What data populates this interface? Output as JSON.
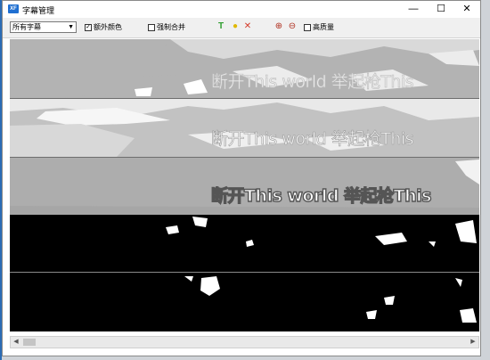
{
  "window": {
    "title": "字幕管理",
    "app_icon": "XF"
  },
  "controls": {
    "minimize": "—",
    "maximize": "☐",
    "close": "✕"
  },
  "toolbar": {
    "dropdown": "所有字幕",
    "extra_color": {
      "label": "额外颜色",
      "checked": true
    },
    "force_merge": {
      "label": "强制合并",
      "checked": false
    },
    "high_quality": {
      "label": "高质量",
      "checked": false
    }
  },
  "strips": [
    {
      "text": "断开This world  举起枪This"
    },
    {
      "text": "断开This world  举起枪This"
    },
    {
      "text": "断开This world  举起枪This"
    }
  ]
}
